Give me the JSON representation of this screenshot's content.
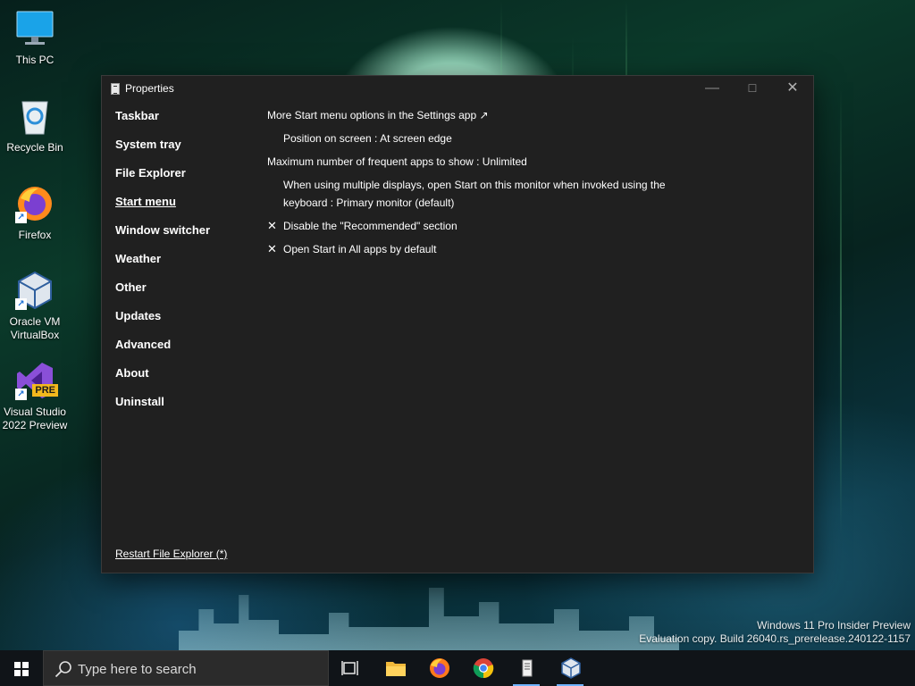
{
  "desktop": {
    "icons": [
      {
        "label": "This PC",
        "icon": "monitor-icon"
      },
      {
        "label": "Recycle Bin",
        "icon": "recycle-bin-icon"
      },
      {
        "label": "Firefox",
        "icon": "firefox-icon"
      },
      {
        "label": "Oracle VM VirtualBox",
        "icon": "virtualbox-icon"
      },
      {
        "label": "Visual Studio 2022 Preview",
        "icon": "visual-studio-icon",
        "badge": "PRE"
      }
    ],
    "watermark": {
      "line1": "Windows 11 Pro Insider Preview",
      "line2": "Evaluation copy. Build 26040.rs_prerelease.240122-1157"
    }
  },
  "window": {
    "title": "Properties",
    "nav": [
      {
        "label": "Taskbar"
      },
      {
        "label": "System tray"
      },
      {
        "label": "File Explorer"
      },
      {
        "label": "Start menu",
        "active": true
      },
      {
        "label": "Window switcher"
      },
      {
        "label": "Weather"
      },
      {
        "label": "Other"
      },
      {
        "label": "Updates"
      },
      {
        "label": "Advanced"
      },
      {
        "label": "About"
      },
      {
        "label": "Uninstall"
      }
    ],
    "settings": {
      "more_options_link": "More Start menu options in the Settings app ↗",
      "position": "Position on screen : At screen edge",
      "max_frequent": "Maximum number of frequent apps to show : Unlimited",
      "multi_display": "When using multiple displays, open Start on this monitor when invoked using the keyboard : Primary monitor (default)",
      "disable_recommended": "Disable the \"Recommended\" section",
      "open_all_apps": "Open Start in All apps by default",
      "check_glyph": "✕"
    },
    "restart_link": "Restart File Explorer (*)"
  },
  "taskbar": {
    "search_placeholder": "Type here to search",
    "apps": [
      "task-view-icon",
      "file-explorer-icon",
      "firefox-icon",
      "chrome-icon",
      "properties-app-icon",
      "virtualbox-icon"
    ],
    "accent": "#6fb3ff"
  }
}
